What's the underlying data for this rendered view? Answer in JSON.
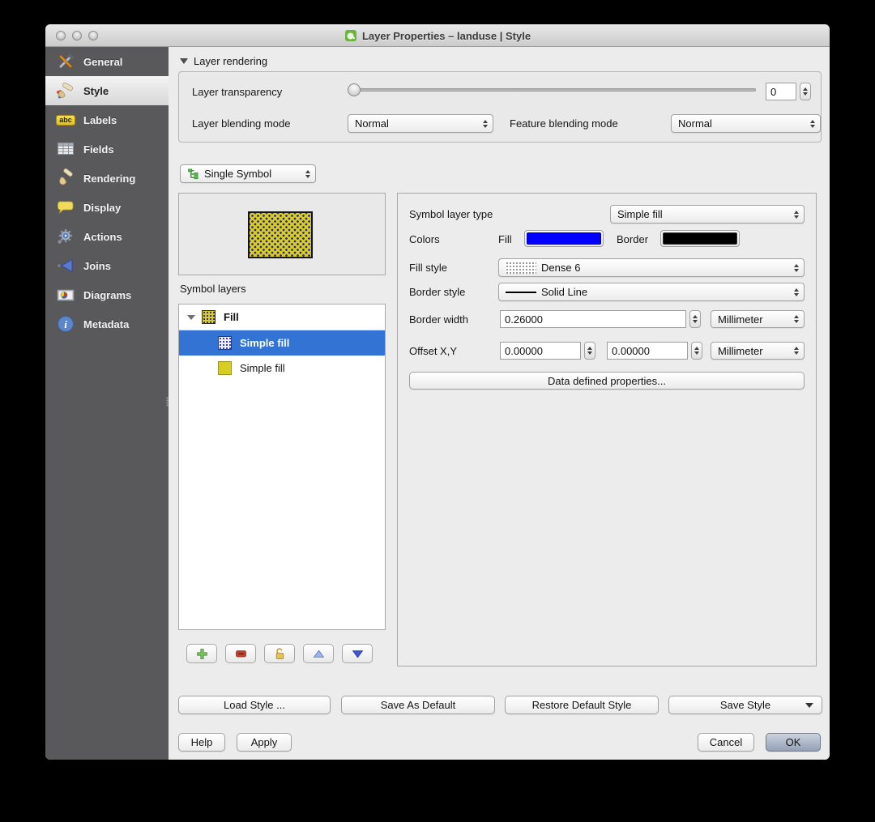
{
  "window": {
    "title": "Layer Properties – landuse | Style"
  },
  "sidebar": {
    "items": [
      {
        "label": "General"
      },
      {
        "label": "Style"
      },
      {
        "label": "Labels",
        "icon_text": "abc"
      },
      {
        "label": "Fields"
      },
      {
        "label": "Rendering"
      },
      {
        "label": "Display"
      },
      {
        "label": "Actions"
      },
      {
        "label": "Joins"
      },
      {
        "label": "Diagrams"
      },
      {
        "label": "Metadata"
      }
    ]
  },
  "layer_rendering": {
    "header": "Layer rendering",
    "transparency_label": "Layer transparency",
    "transparency_value": "0",
    "layer_blending_label": "Layer blending mode",
    "layer_blending_value": "Normal",
    "feature_blending_label": "Feature blending mode",
    "feature_blending_value": "Normal"
  },
  "renderer": {
    "value": "Single Symbol"
  },
  "symbol": {
    "layers_header": "Symbol layers",
    "tree": [
      {
        "label": "Fill"
      },
      {
        "label": "Simple fill"
      },
      {
        "label": "Simple fill"
      }
    ]
  },
  "properties": {
    "symbol_layer_type_label": "Symbol layer type",
    "symbol_layer_type_value": "Simple fill",
    "colors_label": "Colors",
    "fill_label": "Fill",
    "border_label": "Border",
    "fill_style_label": "Fill style",
    "fill_style_value": "Dense 6",
    "border_style_label": "Border style",
    "border_style_value": "Solid Line",
    "border_width_label": "Border width",
    "border_width_value": "0.26000",
    "border_width_unit": "Millimeter",
    "offset_label": "Offset X,Y",
    "offset_x_value": "0.00000",
    "offset_y_value": "0.00000",
    "offset_unit": "Millimeter",
    "data_defined_label": "Data defined properties..."
  },
  "style_buttons": {
    "load": "Load Style ...",
    "save_as_default": "Save As Default",
    "restore_default": "Restore Default Style",
    "save_style": "Save Style"
  },
  "dialog_buttons": {
    "help": "Help",
    "apply": "Apply",
    "cancel": "Cancel",
    "ok": "OK"
  },
  "colors": {
    "fill": "#0000ff",
    "border": "#000000",
    "selection": "#3273d4",
    "symbol_yellow": "#d8cd20"
  }
}
